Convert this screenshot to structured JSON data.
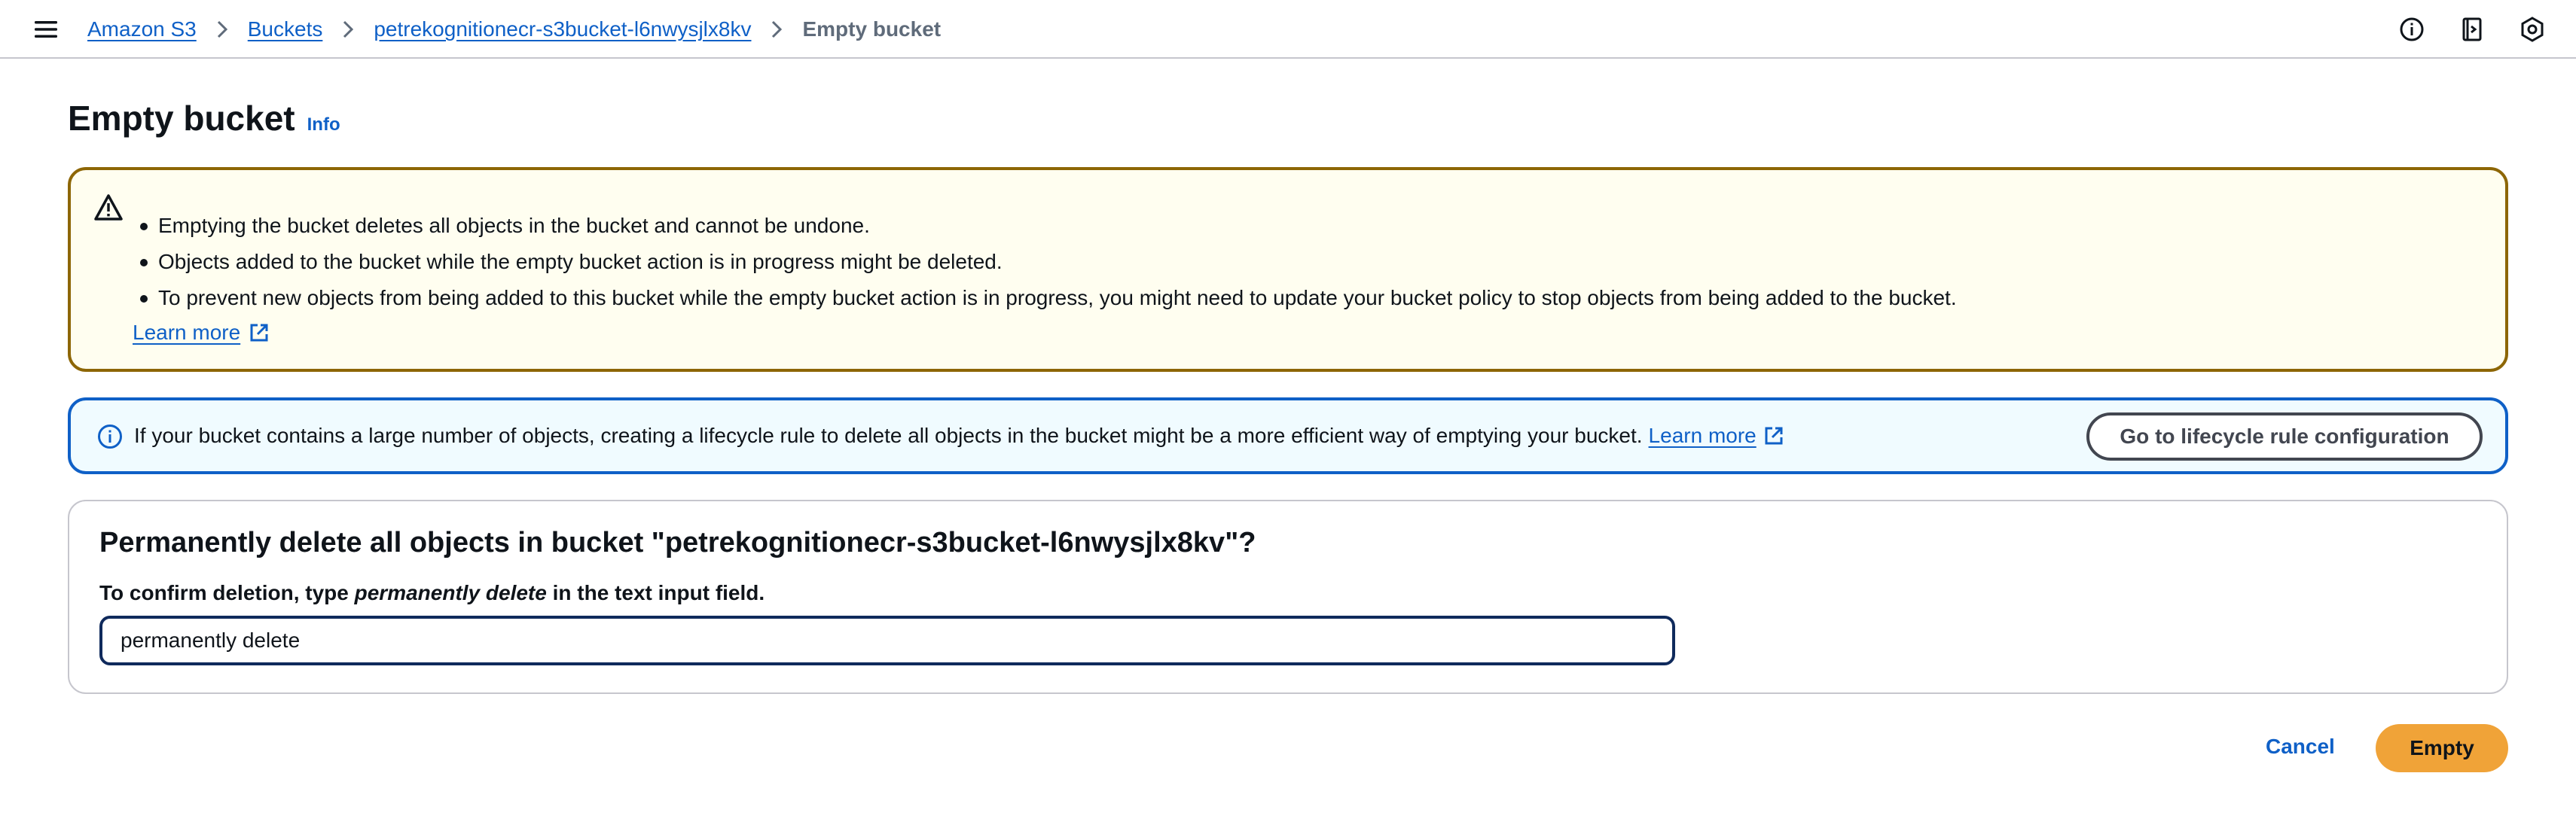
{
  "breadcrumb": {
    "items": [
      "Amazon S3",
      "Buckets",
      "petrekognitionecr-s3bucket-l6nwysjlx8kv"
    ],
    "current": "Empty bucket"
  },
  "icons": {
    "menu": "hamburger-menu-icon",
    "top": [
      "info-circle-icon",
      "notifications-panel-icon",
      "settings-hexagon-icon"
    ],
    "warning": "warning-triangle-icon",
    "info": "info-circle-icon",
    "external": "external-link-icon"
  },
  "page": {
    "title": "Empty bucket",
    "info_label": "Info"
  },
  "warning": {
    "bullets": [
      "Emptying the bucket deletes all objects in the bucket and cannot be undone.",
      "Objects added to the bucket while the empty bucket action is in progress might be deleted.",
      "To prevent new objects from being added to this bucket while the empty bucket action is in progress, you might need to update your bucket policy to stop objects from being added to the bucket."
    ],
    "learn_more": "Learn more"
  },
  "info_alert": {
    "text": "If your bucket contains a large number of objects, creating a lifecycle rule to delete all objects in the bucket might be a more efficient way of emptying your bucket.",
    "learn_more": "Learn more",
    "button_label": "Go to lifecycle rule configuration"
  },
  "confirm": {
    "title": "Permanently delete all objects in bucket \"petrekognitionecr-s3bucket-l6nwysjlx8kv\"?",
    "label_prefix": "To confirm deletion, type ",
    "label_emphasis": "permanently delete",
    "label_suffix": " in the text input field.",
    "input_value": "permanently delete"
  },
  "actions": {
    "cancel_label": "Cancel",
    "empty_label": "Empty"
  },
  "colors": {
    "link": "#0f60c7",
    "warning_border": "#8d6605",
    "warning_bg": "#fffef0",
    "info_border": "#0f60c7",
    "info_bg": "#f0fbff",
    "primary_button": "#f0a338"
  }
}
